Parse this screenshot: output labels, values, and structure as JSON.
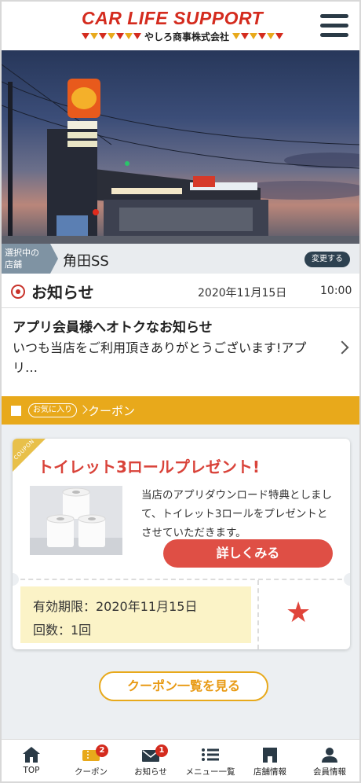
{
  "header": {
    "logo_title": "CAR LIFE SUPPORT",
    "logo_subtitle": "やしろ商事株式会社",
    "menu_icon": "hamburger-menu-icon"
  },
  "store": {
    "tag": "選択中の店舗",
    "tag_line1": "選択中の",
    "tag_line2": "店舗",
    "name": "角田SS",
    "change_label": "変更する"
  },
  "news": {
    "section_title": "お知らせ",
    "date": "2020年11月15日",
    "time": "10:00",
    "item_title": "アプリ会員様へオトクなお知らせ",
    "item_body": "いつも当店をご利用頂きありがとうございます!アプリ…"
  },
  "coupon_section": {
    "favorite_label": "お気に入り",
    "title": "クーポン"
  },
  "coupon": {
    "corner_label": "COUPON",
    "title": "トイレット3ロールプレゼント!",
    "description": "当店のアプリダウンロード特典としまして、トイレット3ロールをプレゼントとさせていただきます。",
    "detail_button": "詳しくみる",
    "validity": "有効期限：2020年11月15日",
    "count": "回数：1回",
    "favorited": true,
    "accent_color": "#df4f45"
  },
  "all_coupons_button": "クーポン一覧を見る",
  "tabbar": {
    "items": [
      {
        "label": "TOP",
        "icon": "home-icon",
        "badge": ""
      },
      {
        "label": "クーポン",
        "icon": "coupon-ticket-icon",
        "badge": "2"
      },
      {
        "label": "お知らせ",
        "icon": "mail-icon",
        "badge": "1"
      },
      {
        "label": "メニュー一覧",
        "icon": "list-menu-icon",
        "badge": ""
      },
      {
        "label": "店舗情報",
        "icon": "store-icon",
        "badge": ""
      },
      {
        "label": "会員情報",
        "icon": "member-icon",
        "badge": ""
      }
    ]
  },
  "colors": {
    "brand_red": "#d42b1e",
    "brand_yellow": "#e8a91b",
    "dark_navy": "#2d4150"
  }
}
